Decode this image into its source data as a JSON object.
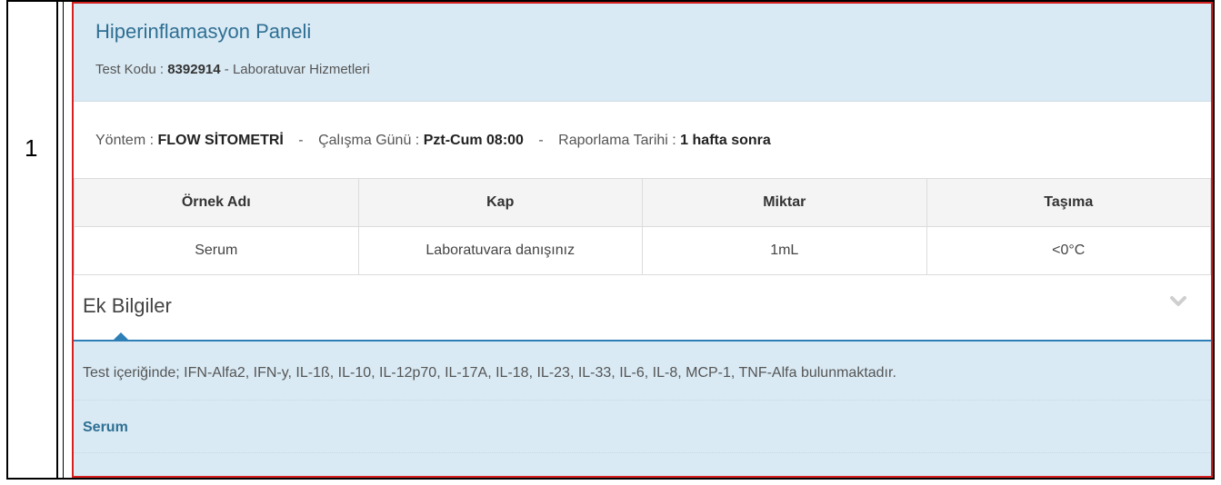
{
  "row_number": "1",
  "panel": {
    "title": "Hiperinflamasyon Paneli",
    "code_label": "Test Kodu :",
    "code": "8392914",
    "department": "- Laboratuvar Hizmetleri"
  },
  "info": {
    "method_label": "Yöntem :",
    "method": "FLOW SİTOMETRİ",
    "day_label": "Çalışma Günü :",
    "day": "Pzt-Cum 08:00",
    "report_label": "Raporlama Tarihi :",
    "report": "1 hafta sonra",
    "separator": "-"
  },
  "table": {
    "headers": [
      "Örnek Adı",
      "Kap",
      "Miktar",
      "Taşıma"
    ],
    "rows": [
      [
        "Serum",
        "Laboratuvara danışınız",
        "1mL",
        "<0°C"
      ]
    ]
  },
  "extra": {
    "title": "Ek Bilgiler",
    "toggle_icon": "chevron-down-icon",
    "content": "Test içeriğinde; IFN-Alfa2, IFN-y, IL-1ß, IL-10, IL-12p70, IL-17A, IL-18, IL-23, IL-33, IL-6, IL-8, MCP-1, TNF-Alfa bulunmaktadır.",
    "sample": "Serum"
  },
  "colors": {
    "accent": "#2f6f93",
    "header_bg": "#d9eaf4",
    "panel_border": "#d62020"
  }
}
